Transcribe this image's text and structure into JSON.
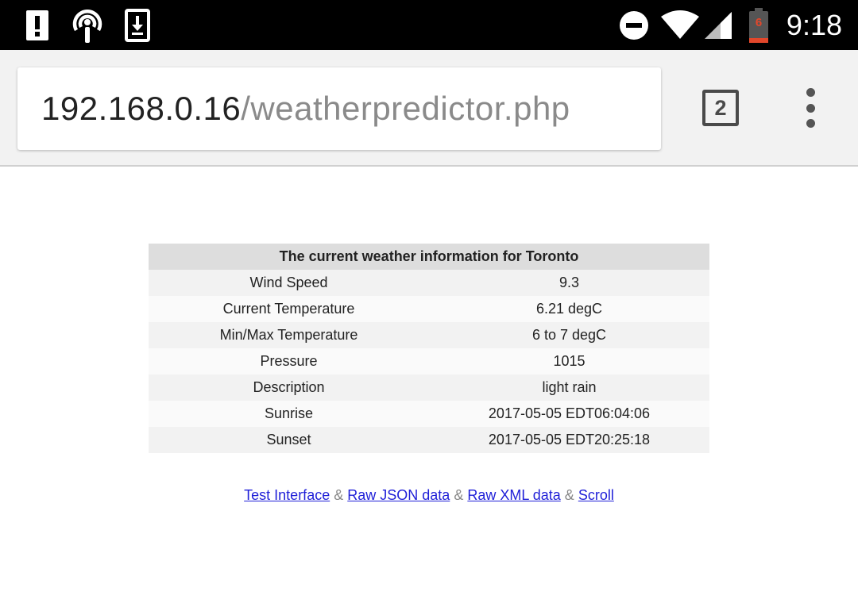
{
  "status_bar": {
    "time": "9:18",
    "battery_level": "6",
    "icons": [
      "alert-icon",
      "podcast-icon",
      "download-icon",
      "do-not-disturb-icon",
      "wifi-icon",
      "cell-signal-icon",
      "battery-icon"
    ]
  },
  "browser": {
    "url_host": "192.168.0.16",
    "url_path": "/weatherpredictor.php",
    "tab_count": "2"
  },
  "weather": {
    "title": "The current weather information for Toronto",
    "rows": [
      {
        "label": "Wind Speed",
        "value": "9.3"
      },
      {
        "label": "Current Temperature",
        "value": "6.21 degC"
      },
      {
        "label": "Min/Max Temperature",
        "value": "6 to 7 degC"
      },
      {
        "label": "Pressure",
        "value": "1015"
      },
      {
        "label": "Description",
        "value": "light rain"
      },
      {
        "label": "Sunrise",
        "value": "2017-05-05 EDT06:04:06"
      },
      {
        "label": "Sunset",
        "value": "2017-05-05 EDT20:25:18"
      }
    ]
  },
  "links": {
    "items": [
      "Test Interface",
      "Raw JSON data",
      "Raw XML data",
      "Scroll"
    ],
    "separator": "&"
  },
  "colors": {
    "battery_accent": "#e2472b",
    "link": "#1f1fd8",
    "table_header": "#dddddd"
  }
}
